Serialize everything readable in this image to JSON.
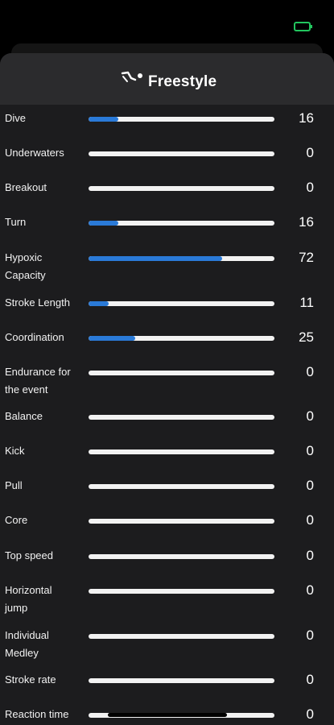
{
  "header": {
    "title": "Freestyle",
    "icon": "swimmer-icon"
  },
  "colors": {
    "accent": "#2a7ad8",
    "track": "#f2f2f2",
    "battery": "#22c55e"
  },
  "metrics": [
    {
      "label": "Dive",
      "value": "16",
      "progress": 0.16
    },
    {
      "label": "Underwaters",
      "value": "0",
      "progress": 0
    },
    {
      "label": "Breakout",
      "value": "0",
      "progress": 0
    },
    {
      "label": "Turn",
      "value": "16",
      "progress": 0.16
    },
    {
      "label": "Hypoxic Capacity",
      "value": "72",
      "progress": 0.72
    },
    {
      "label": "Stroke Length",
      "value": "11",
      "progress": 0.11
    },
    {
      "label": "Coordination",
      "value": "25",
      "progress": 0.25
    },
    {
      "label": "Endurance for the event",
      "value": "0",
      "progress": 0
    },
    {
      "label": "Balance",
      "value": "0",
      "progress": 0
    },
    {
      "label": "Kick",
      "value": "0",
      "progress": 0
    },
    {
      "label": "Pull",
      "value": "0",
      "progress": 0
    },
    {
      "label": "Core",
      "value": "0",
      "progress": 0
    },
    {
      "label": "Top speed",
      "value": "0",
      "progress": 0
    },
    {
      "label": "Horizontal jump",
      "value": "0",
      "progress": 0
    },
    {
      "label": "Individual Medley",
      "value": "0",
      "progress": 0
    },
    {
      "label": "Stroke rate",
      "value": "0",
      "progress": 0
    },
    {
      "label": "Reaction time",
      "value": "0",
      "progress": 0
    }
  ]
}
